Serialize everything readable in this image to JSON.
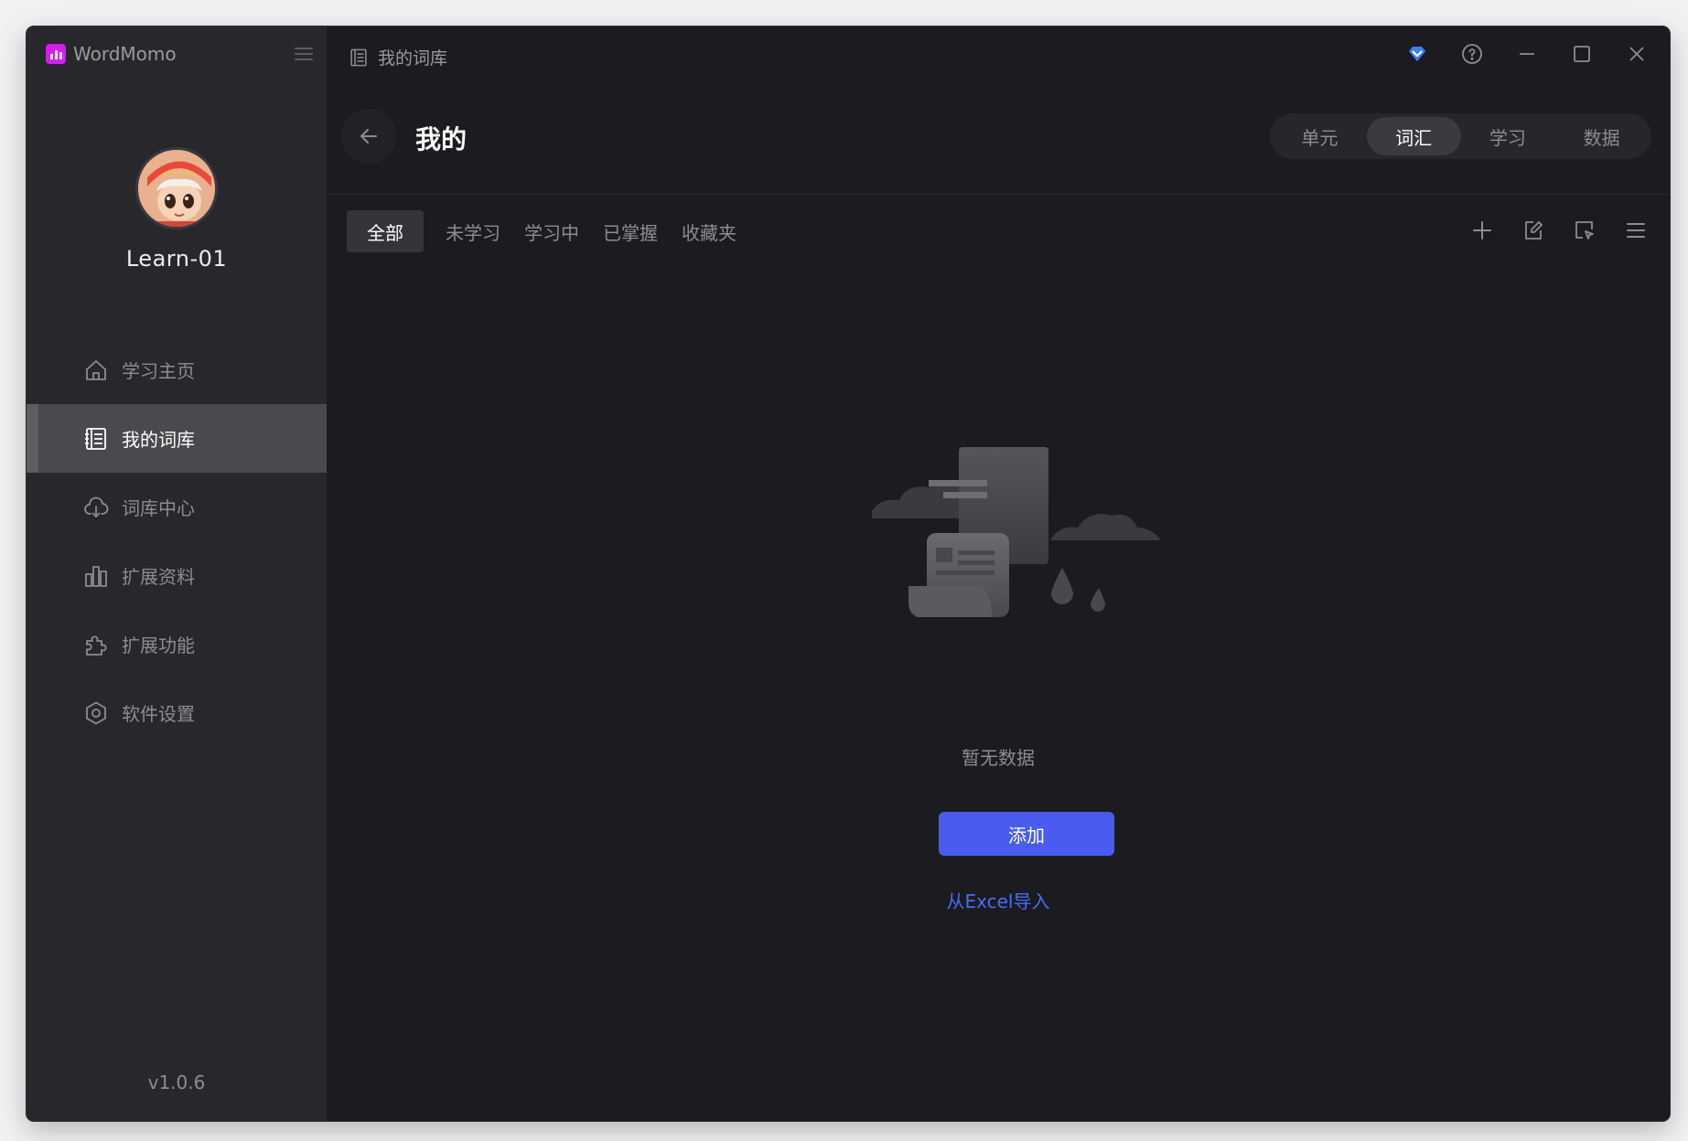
{
  "app": {
    "name": "WordMomo",
    "version": "v1.0.6"
  },
  "user": {
    "name": "Learn-01"
  },
  "sidebar": {
    "items": [
      {
        "label": "学习主页",
        "icon": "home-icon"
      },
      {
        "label": "我的词库",
        "icon": "book-list-icon",
        "active": true
      },
      {
        "label": "词库中心",
        "icon": "cloud-download-icon"
      },
      {
        "label": "扩展资料",
        "icon": "bar-chart-icon"
      },
      {
        "label": "扩展功能",
        "icon": "puzzle-icon"
      },
      {
        "label": "软件设置",
        "icon": "settings-hexagon-icon"
      }
    ]
  },
  "titlebar": {
    "breadcrumb": "我的词库"
  },
  "header": {
    "title": "我的",
    "segments": [
      {
        "label": "单元"
      },
      {
        "label": "词汇",
        "active": true
      },
      {
        "label": "学习"
      },
      {
        "label": "数据"
      }
    ]
  },
  "filters": [
    {
      "label": "全部",
      "active": true
    },
    {
      "label": "未学习"
    },
    {
      "label": "学习中"
    },
    {
      "label": "已掌握"
    },
    {
      "label": "收藏夹"
    }
  ],
  "empty": {
    "message": "暂无数据",
    "add_label": "添加",
    "import_label": "从Excel导入"
  },
  "colors": {
    "accent": "#4a5cf0",
    "link": "#4a6cf5",
    "vip": "#3b82f6",
    "brand": "#d21ef0",
    "background": "#1b1b20",
    "sidebar": "#27272c"
  }
}
